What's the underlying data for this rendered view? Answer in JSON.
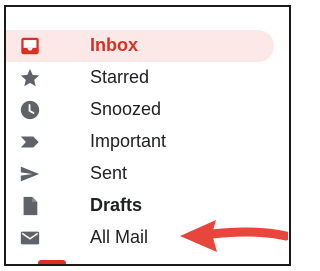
{
  "nav": {
    "items": [
      {
        "label": "Inbox",
        "icon": "inbox-icon",
        "active": true
      },
      {
        "label": "Starred",
        "icon": "star-icon"
      },
      {
        "label": "Snoozed",
        "icon": "clock-icon"
      },
      {
        "label": "Important",
        "icon": "important-icon"
      },
      {
        "label": "Sent",
        "icon": "send-icon"
      },
      {
        "label": "Drafts",
        "icon": "draft-icon",
        "bold": true
      },
      {
        "label": "All Mail",
        "icon": "mail-icon"
      }
    ]
  },
  "colors": {
    "accent": "#d93025",
    "active_bg": "#fce8e6",
    "icon": "#5f6368",
    "text": "#202124",
    "annotation_arrow": "#e8453c"
  },
  "annotation": {
    "type": "arrow",
    "points_to": "All Mail"
  }
}
